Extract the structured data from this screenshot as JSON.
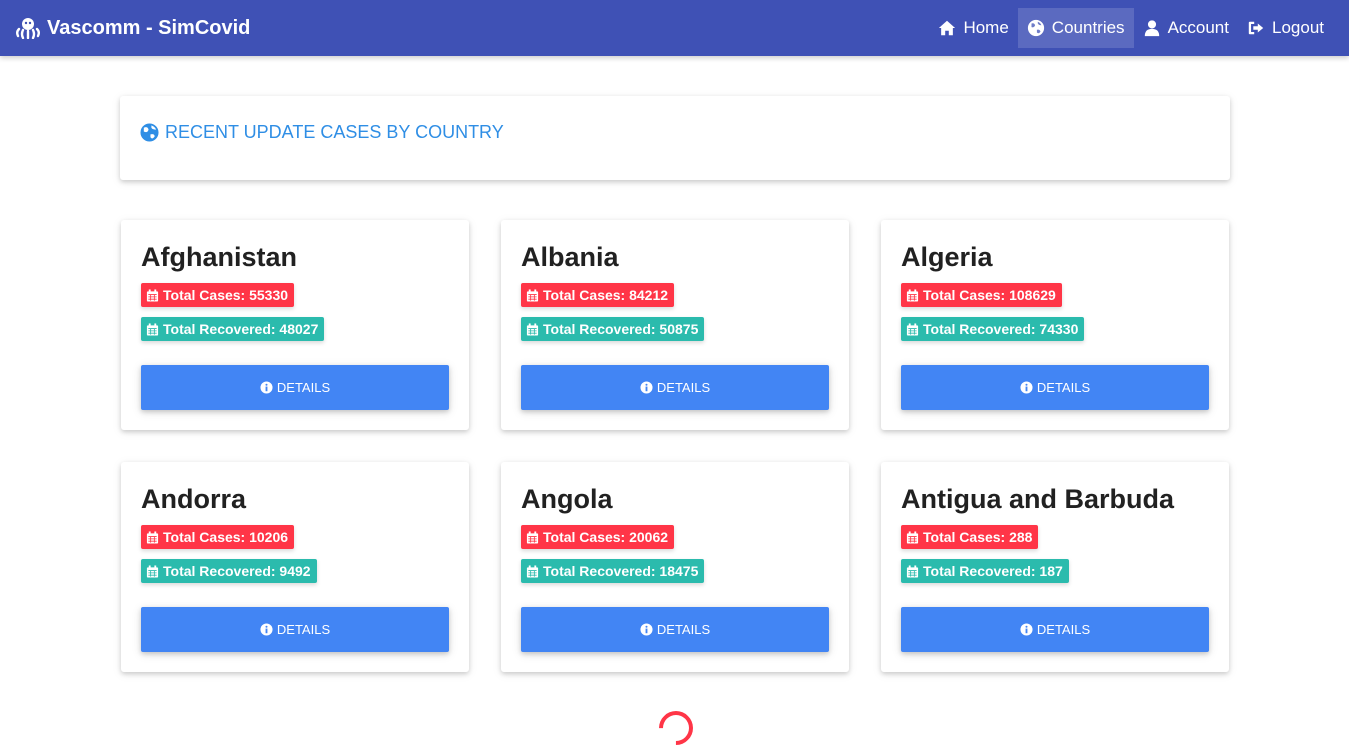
{
  "navbar": {
    "brand": "Vascomm - SimCovid",
    "brand_icon": "octopus-icon",
    "items": [
      {
        "label": "Home",
        "icon": "home-icon",
        "active": false
      },
      {
        "label": "Countries",
        "icon": "globe-icon",
        "active": true
      },
      {
        "label": "Account",
        "icon": "user-icon",
        "active": false
      },
      {
        "label": "Logout",
        "icon": "logout-icon",
        "active": false
      }
    ]
  },
  "header": {
    "title": "RECENT UPDATE CASES BY COUNTRY",
    "icon": "globe-icon",
    "color": "#2f8ee5"
  },
  "colors": {
    "navbar": "#3f51b5",
    "cases_badge": "#ff3547",
    "recovered_badge": "#2bbbad",
    "button": "#4285f4"
  },
  "countries": [
    {
      "name": "Afghanistan",
      "cases": "Total Cases: 55330",
      "recovered": "Total Recovered: 48027",
      "button": "DETAILS"
    },
    {
      "name": "Albania",
      "cases": "Total Cases: 84212",
      "recovered": "Total Recovered: 50875",
      "button": "DETAILS"
    },
    {
      "name": "Algeria",
      "cases": "Total Cases: 108629",
      "recovered": "Total Recovered: 74330",
      "button": "DETAILS"
    },
    {
      "name": "Andorra",
      "cases": "Total Cases: 10206",
      "recovered": "Total Recovered: 9492",
      "button": "DETAILS"
    },
    {
      "name": "Angola",
      "cases": "Total Cases: 20062",
      "recovered": "Total Recovered: 18475",
      "button": "DETAILS"
    },
    {
      "name": "Antigua and Barbuda",
      "cases": "Total Cases: 288",
      "recovered": "Total Recovered: 187",
      "button": "DETAILS"
    }
  ],
  "loading_indicator": "spinner-icon"
}
